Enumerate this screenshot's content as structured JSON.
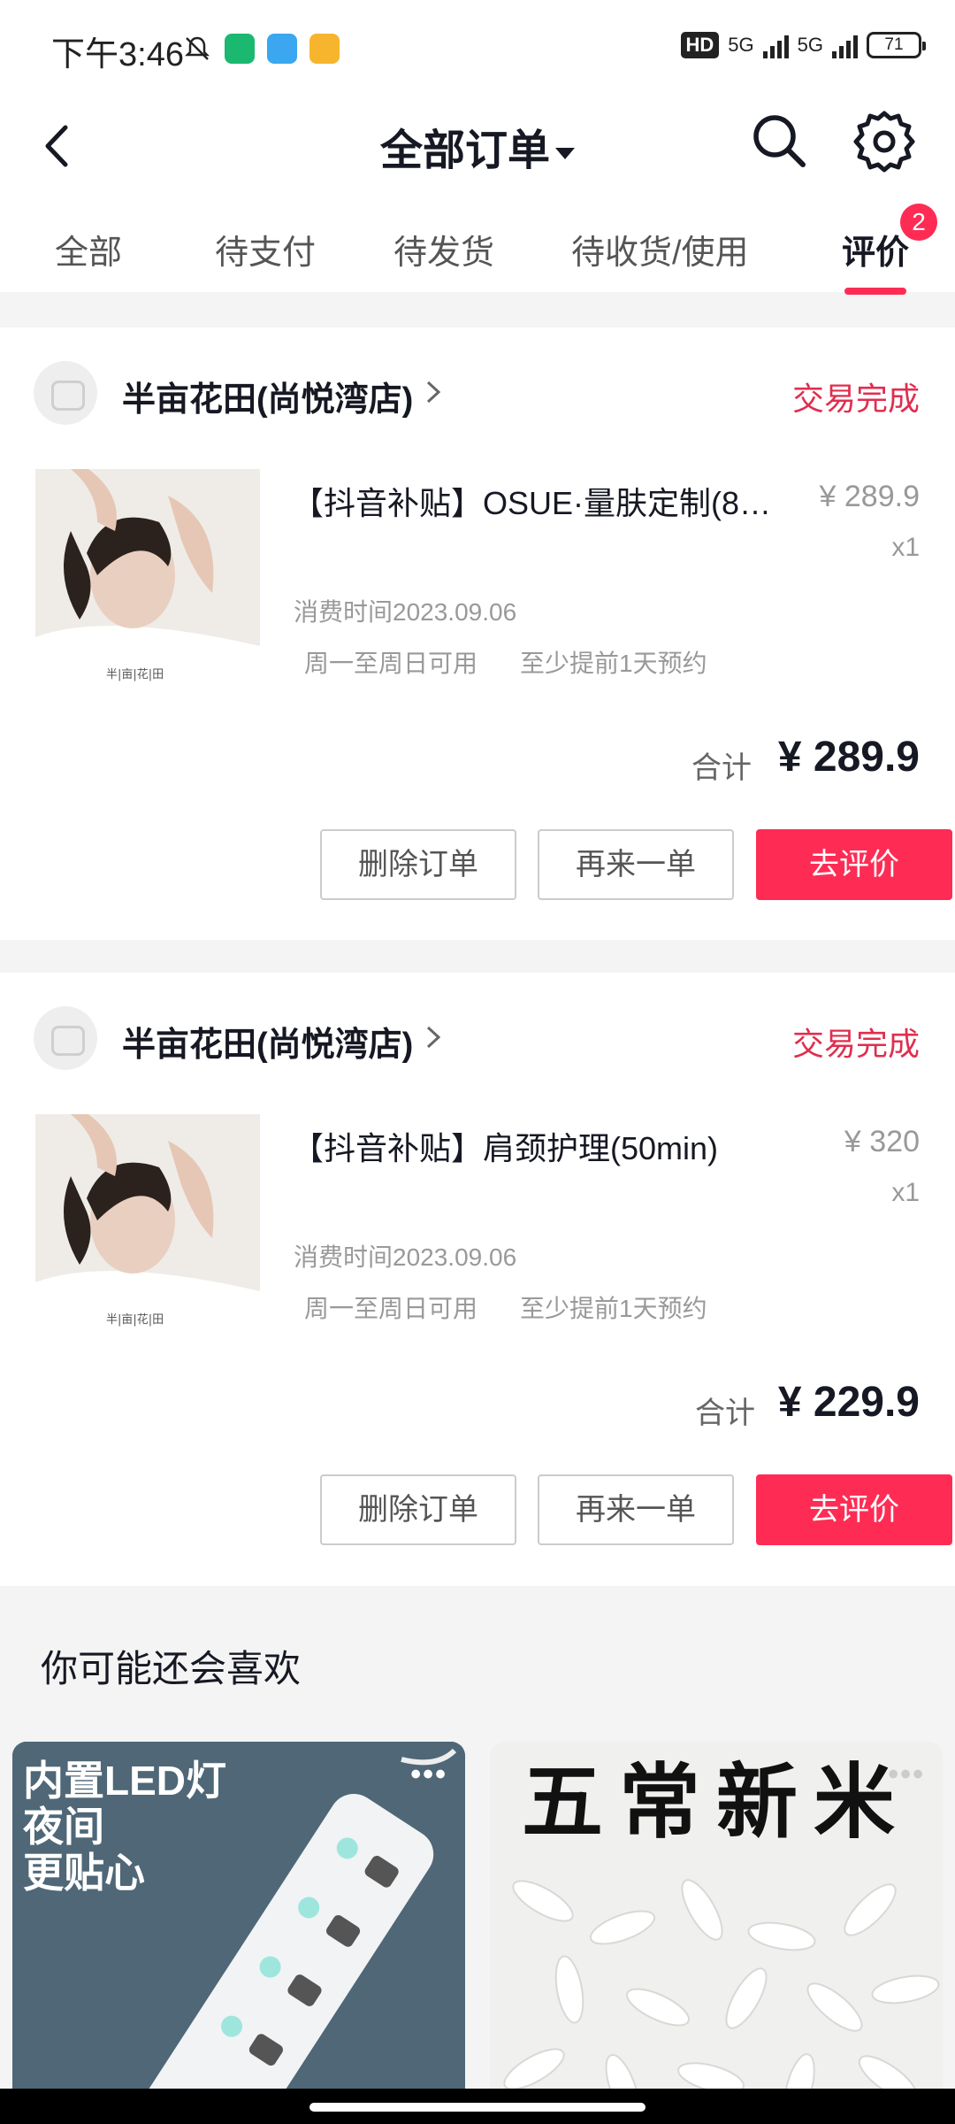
{
  "status_bar": {
    "time": "下午3:46",
    "hd_label": "HD",
    "net1": "5G",
    "net2": "5G",
    "battery": "71"
  },
  "nav": {
    "title": "全部订单",
    "back_icon": "chevron-left-icon",
    "search_icon": "search-icon",
    "settings_icon": "gear-icon"
  },
  "tabs": [
    {
      "label": "全部"
    },
    {
      "label": "待支付"
    },
    {
      "label": "待发货"
    },
    {
      "label": "待收货/使用"
    },
    {
      "label": "评价",
      "badge": "2"
    }
  ],
  "orders": [
    {
      "store": "半亩花田(尚悦湾店)",
      "status": "交易完成",
      "title": "【抖音补贴】OSUE·量肤定制(8…",
      "price": "¥ 289.9",
      "qty": "x1",
      "consume_time": "消费时间2023.09.06",
      "tag_days": "周一至周日可用",
      "tag_booking": "至少提前1天预约",
      "total_label": "合计",
      "total": "¥ 289.9",
      "btn_delete": "删除订单",
      "btn_reorder": "再来一单",
      "btn_review": "去评价"
    },
    {
      "store": "半亩花田(尚悦湾店)",
      "status": "交易完成",
      "title": "【抖音补贴】肩颈护理(50min)",
      "price": "¥ 320",
      "qty": "x1",
      "consume_time": "消费时间2023.09.06",
      "tag_days": "周一至周日可用",
      "tag_booking": "至少提前1天预约",
      "total_label": "合计",
      "total": "¥ 229.9",
      "btn_delete": "删除订单",
      "btn_reorder": "再来一单",
      "btn_review": "去评价"
    }
  ],
  "recommend": {
    "title": "你可能还会喜欢",
    "items": [
      {
        "caption_lines": [
          "内置LED灯",
          "夜间",
          "更贴心"
        ],
        "more": "•••"
      },
      {
        "caption": "五常新米",
        "more": "•••"
      }
    ]
  },
  "thumb_watermark": "半|亩|花|田",
  "colors": {
    "accent": "#fe2c55",
    "status": "#e02e4e"
  }
}
